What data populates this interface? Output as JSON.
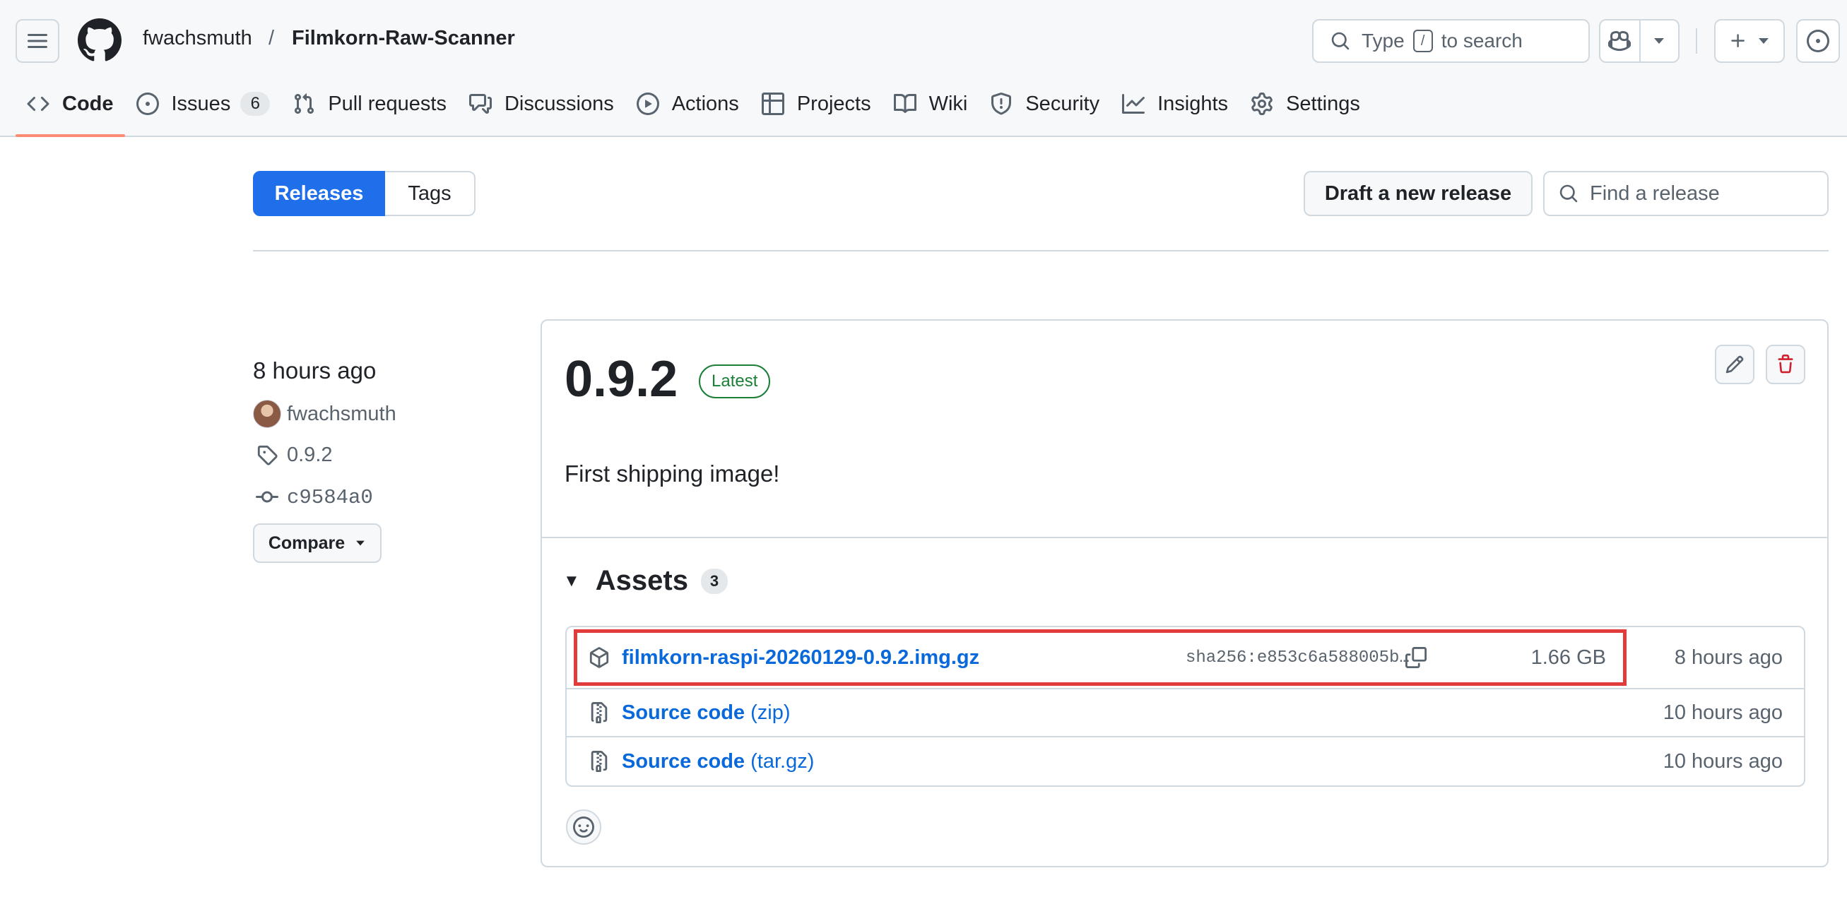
{
  "header": {
    "owner": "fwachsmuth",
    "slash": "/",
    "repo": "Filmkorn-Raw-Scanner",
    "search_prefix": "Type",
    "search_key": "/",
    "search_suffix": "to search",
    "icons": [
      "menu-icon",
      "github-logo-icon",
      "search-icon",
      "copilot-icon",
      "triangle-down-icon",
      "plus-icon",
      "issue-opened-icon"
    ]
  },
  "repo_nav": {
    "items": [
      {
        "label": "Code",
        "icon": "code-icon",
        "selected": true
      },
      {
        "label": "Issues",
        "icon": "issue-opened-icon",
        "count": "6"
      },
      {
        "label": "Pull requests",
        "icon": "git-pull-request-icon"
      },
      {
        "label": "Discussions",
        "icon": "comment-discussion-icon"
      },
      {
        "label": "Actions",
        "icon": "play-icon"
      },
      {
        "label": "Projects",
        "icon": "table-icon"
      },
      {
        "label": "Wiki",
        "icon": "book-icon"
      },
      {
        "label": "Security",
        "icon": "shield-icon"
      },
      {
        "label": "Insights",
        "icon": "graph-icon"
      },
      {
        "label": "Settings",
        "icon": "gear-icon"
      }
    ]
  },
  "subnav": {
    "releases_label": "Releases",
    "tags_label": "Tags",
    "draft_label": "Draft a new release",
    "find_placeholder": "Find a release"
  },
  "release_meta": {
    "time": "8 hours ago",
    "author": "fwachsmuth",
    "tag": "0.9.2",
    "commit": "c9584a0",
    "compare_label": "Compare"
  },
  "release": {
    "title": "0.9.2",
    "badge": "Latest",
    "body": "First shipping image!",
    "assets_title": "Assets",
    "assets_count": "3",
    "assets": [
      {
        "name": "filmkorn-raspi-20260129-0.9.2.img.gz",
        "digest": "sha256:e853c6a588005b…",
        "size": "1.66 GB",
        "time": "8 hours ago",
        "icon": "package-icon",
        "highlighted": true
      },
      {
        "name": "Source code",
        "suffix": "(zip)",
        "time": "10 hours ago",
        "icon": "file-zip-icon"
      },
      {
        "name": "Source code",
        "suffix": "(tar.gz)",
        "time": "10 hours ago",
        "icon": "file-zip-icon"
      }
    ]
  },
  "colors": {
    "accent": "#1f6feb",
    "link": "#0969da",
    "latest_badge": "#1a7f37",
    "delete_icon": "#cf222e",
    "nav_underline": "#fd8c73",
    "highlight_box": "#e03c3c"
  }
}
